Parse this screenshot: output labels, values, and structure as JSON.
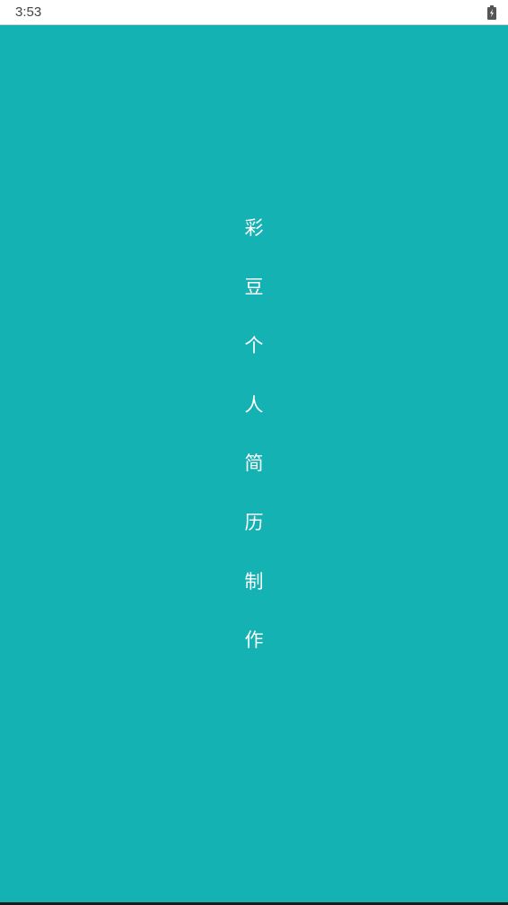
{
  "status_bar": {
    "time": "3:53",
    "battery_icon": "battery-charging-icon"
  },
  "splash": {
    "background_color": "#15b2b3",
    "title_chars": [
      "彩",
      "豆",
      "个",
      "人",
      "简",
      "历",
      "制",
      "作"
    ]
  }
}
